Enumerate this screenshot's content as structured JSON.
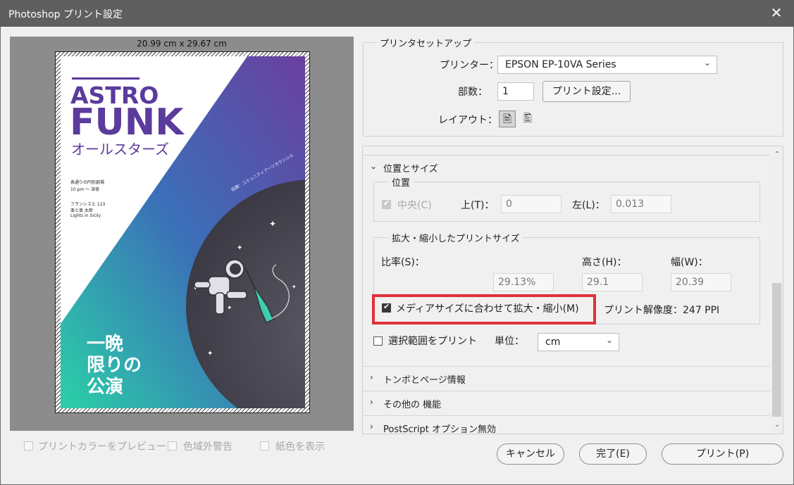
{
  "window": {
    "title": "Photoshop プリント設定",
    "close_symbol": "✕"
  },
  "preview": {
    "paper_size": "20.99 cm x 29.67 cm",
    "poster": {
      "line1": "ASTRO",
      "line2": "FUNK",
      "line3": "オールスターズ",
      "small1": "表通りの円形劇場",
      "small2": "10 pm ～ 深夜",
      "small3": "フランシスと 123",
      "small4": "亜土美 太郎",
      "small5": "Lights in Sicily",
      "side": "協賛：コミュニティアーツカウンシル",
      "big1": "一晩",
      "big2": "限りの",
      "big3": "公演"
    },
    "checkboxes": [
      {
        "label": "プリントカラーをプレビュー",
        "checked": false
      },
      {
        "label": "色域外警告",
        "checked": false
      },
      {
        "label": "紙色を表示",
        "checked": false
      }
    ]
  },
  "printer_setup": {
    "group_label": "プリンタセットアップ",
    "printer_label": "プリンター：",
    "printer_value": "EPSON EP-10VA Series",
    "copies_label": "部数：",
    "copies_value": "1",
    "print_settings_button": "プリント設定...",
    "layout_label": "レイアウト："
  },
  "position_size": {
    "section_label": "位置とサイズ",
    "position": {
      "group_label": "位置",
      "center_label": "中央(C)",
      "top_label": "上(T)：",
      "top_value": "0",
      "left_label": "左(L)：",
      "left_value": "0.013"
    },
    "scaled": {
      "group_label": "拡大・縮小したプリントサイズ",
      "scale_label": "比率(S)：",
      "height_label": "高さ(H)：",
      "width_label": "幅(W)：",
      "scale_value": "29.13%",
      "height_value": "29.1",
      "width_value": "20.39",
      "fit_media_label": "メディアサイズに合わせて拡大・縮小(M)",
      "resolution_text": "プリント解像度：247 PPI"
    },
    "print_selection_label": "選択範囲をプリント",
    "units_label": "単位：",
    "units_value": "cm"
  },
  "sections": [
    {
      "label": "トンボとページ情報"
    },
    {
      "label": "その他の 機能"
    },
    {
      "label": "PostScript オプション無効"
    }
  ],
  "buttons": {
    "cancel": "キャンセル",
    "done": "完了(E)",
    "print": "プリント(P)"
  },
  "colors": {
    "titlebar": "#5f5f5f",
    "highlight": "#e0303a",
    "poster_purple": "#5b3b9c",
    "poster_teal": "#2bd0a8"
  }
}
